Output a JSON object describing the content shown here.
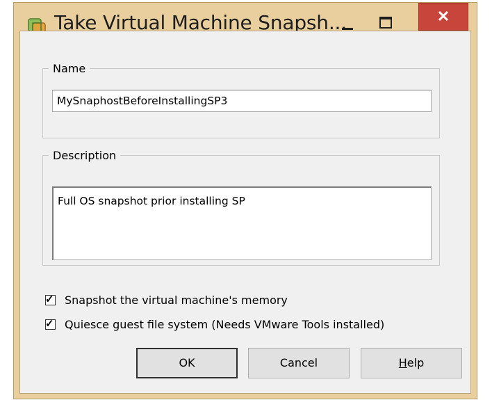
{
  "window": {
    "title": "Take Virtual Machine Snapsh...",
    "close_glyph": "✕",
    "icon": "vmware-snapshot-icon"
  },
  "name_group": {
    "legend": "Name",
    "value": "MySnaphostBeforeInstallingSP3"
  },
  "description_group": {
    "legend": "Description",
    "value": "Full OS snapshot prior installing SP"
  },
  "options": [
    {
      "label": "Snapshot the virtual machine's memory",
      "checked": true
    },
    {
      "label": "Quiesce guest file system (Needs VMware Tools installed)",
      "checked": true
    }
  ],
  "buttons": {
    "ok": "OK",
    "cancel": "Cancel",
    "help_mnemonic": "H",
    "help_rest": "elp"
  },
  "colors": {
    "frame": "#e9cf9e",
    "close": "#c7453a",
    "client": "#f0f0f0"
  }
}
